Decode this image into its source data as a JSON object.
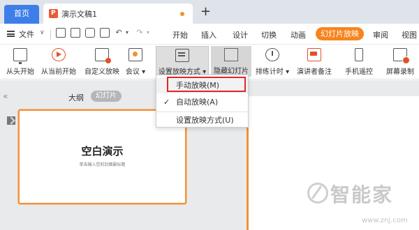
{
  "tabs": {
    "home": "首页",
    "document": "演示文稿1",
    "new_tab": "+"
  },
  "menu": {
    "file": "文件",
    "file_chevron": "∨",
    "ribbon_tabs": [
      "开始",
      "插入",
      "设计",
      "切换",
      "动画",
      "幻灯片放映",
      "审阅",
      "视图"
    ],
    "active_tab": "幻灯片放映"
  },
  "quick_access": {
    "undo": "↶",
    "redo": "↷",
    "undo_chev": "▾",
    "redo_chev": "▾"
  },
  "toolbar": [
    {
      "label": "从头开始",
      "icon": "screen-icon"
    },
    {
      "label": "从当前开始",
      "icon": "play-circle-icon"
    },
    {
      "label": "自定义放映",
      "icon": "custom-show-icon"
    },
    {
      "label": "会议 ▾",
      "icon": "meeting-icon"
    },
    {
      "label": "设置放映方式 ▾",
      "icon": "setup-show-icon"
    },
    {
      "label": "隐藏幻灯片",
      "icon": "hide-slide-icon"
    },
    {
      "label": "排练计时 ▾",
      "icon": "timer-icon"
    },
    {
      "label": "演讲者备注",
      "icon": "presenter-notes-icon"
    },
    {
      "label": "手机遥控",
      "icon": "phone-remote-icon"
    },
    {
      "label": "屏幕录制",
      "icon": "screen-record-icon"
    }
  ],
  "panel": {
    "collapse": "«",
    "outline": "大纲",
    "slides": "幻灯片"
  },
  "slide": {
    "title": "空白演示",
    "subtitle": "单击输入您的封面副标题"
  },
  "dropdown": {
    "manual": "手动放映(M)",
    "auto": "自动放映(A)",
    "auto_check": "✓",
    "setup": "设置放映方式(U)"
  },
  "watermark": {
    "text": "智能家",
    "url": "www.znj.com"
  },
  "colors": {
    "accent": "#f7841e",
    "home_tab": "#3e7ee8",
    "highlight_border": "#e3232a"
  }
}
